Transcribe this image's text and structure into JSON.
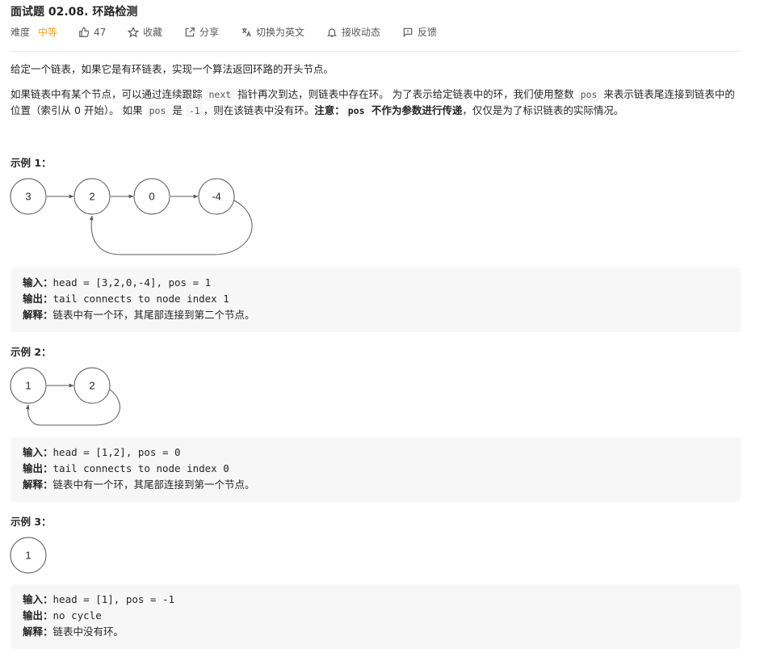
{
  "header": {
    "title": "面试题 02.08. 环路检测",
    "difficulty_label": "难度",
    "difficulty_value": "中等",
    "like_count": "47",
    "favorite_label": "收藏",
    "share_label": "分享",
    "translate_label": "切换为英文",
    "notify_label": "接收动态",
    "feedback_label": "反馈"
  },
  "description": {
    "p1": "给定一个链表，如果它是有环链表，实现一个算法返回环路的开头节点。",
    "p2_a": "如果链表中有某个节点，可以通过连续跟踪 ",
    "p2_code_next": "next",
    "p2_b": " 指针再次到达，则链表中存在环。 为了表示给定链表中的环，我们使用整数 ",
    "p2_code_pos": "pos",
    "p2_c": " 来表示链表尾连接到链表中的位置（索引从 0 开始）。 如果 ",
    "p2_code_pos2": "pos",
    "p2_d": " 是 ",
    "p2_code_neg1": "-1",
    "p2_e": "，则在该链表中没有环。",
    "p2_note": "注意：",
    "p2_code_pos3": "pos",
    "p2_note2": " 不作为参数进行传递",
    "p2_f": "，仅仅是为了标识链表的实际情况。"
  },
  "examples": [
    {
      "label": "示例 1：",
      "nodes": [
        "3",
        "2",
        "0",
        "-4"
      ],
      "input_label": "输入：",
      "input": "head = [3,2,0,-4], pos = 1",
      "output_label": "输出：",
      "output": "tail connects to node index 1",
      "explain_label": "解释：",
      "explain": "链表中有一个环，其尾部连接到第二个节点。"
    },
    {
      "label": "示例 2：",
      "nodes": [
        "1",
        "2"
      ],
      "input_label": "输入：",
      "input": "head = [1,2], pos = 0",
      "output_label": "输出：",
      "output": "tail connects to node index 0",
      "explain_label": "解释：",
      "explain": "链表中有一个环，其尾部连接到第一个节点。"
    },
    {
      "label": "示例 3：",
      "nodes": [
        "1"
      ],
      "input_label": "输入：",
      "input": "head = [1], pos = -1",
      "output_label": "输出：",
      "output": "no cycle",
      "explain_label": "解释：",
      "explain": "链表中没有环。"
    }
  ],
  "colors": {
    "difficulty_medium": "#ffa116",
    "text": "#262626",
    "muted": "#595959",
    "code_bg": "#f7f7f8"
  }
}
